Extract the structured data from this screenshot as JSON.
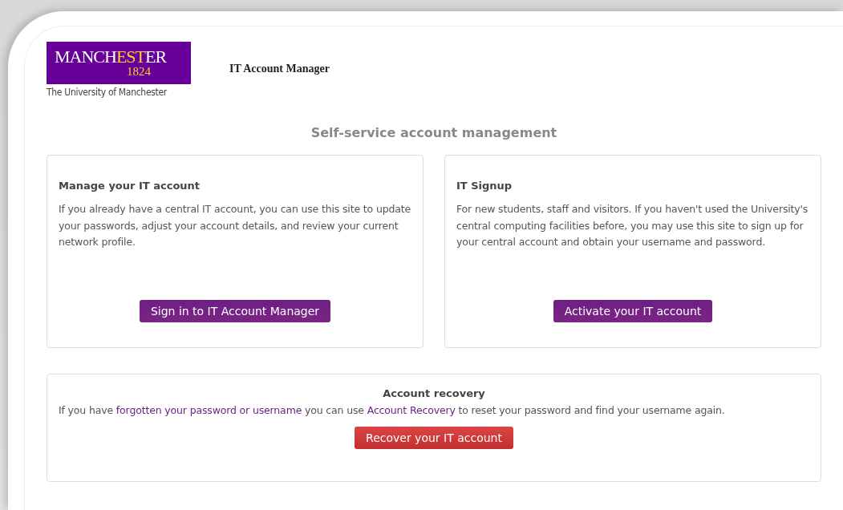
{
  "logo": {
    "wordmark_before": "MANCH",
    "wordmark_accent": "EST",
    "wordmark_after": "ER",
    "year": "1824",
    "caption": "The University of Manchester"
  },
  "app_title": "IT Account Manager",
  "heading": "Self-service account management",
  "cards": [
    {
      "title": "Manage your IT account",
      "text": "If you already have a central IT account, you can use this site to update your passwords, adjust your account details, and review your current network profile.",
      "button": "Sign in to IT Account Manager"
    },
    {
      "title": "IT Signup",
      "text": "For new students, staff and visitors. If you haven't used the University's central computing facilities before, you may use this site to sign up for your central account and obtain your username and password.",
      "button": "Activate your IT account"
    }
  ],
  "recovery": {
    "title": "Account recovery",
    "parts": [
      {
        "kind": "text",
        "text": "If you have "
      },
      {
        "kind": "link",
        "text": "forgotten your password or username"
      },
      {
        "kind": "text",
        "text": " you can use "
      },
      {
        "kind": "link",
        "text": "Account Recovery"
      },
      {
        "kind": "text",
        "text": " to reset your password and find your username again."
      }
    ],
    "button": "Recover your IT account"
  }
}
